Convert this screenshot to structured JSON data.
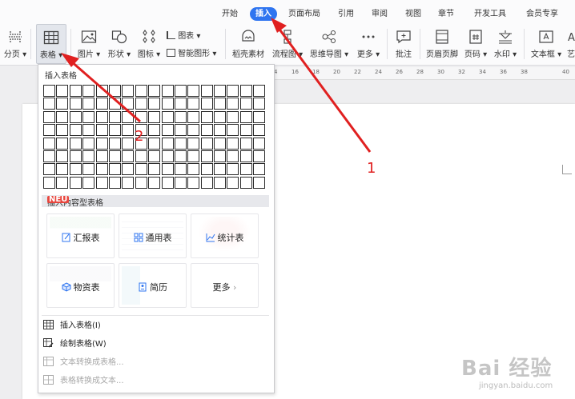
{
  "menu": {
    "tabs": [
      "开始",
      "插入",
      "页面布局",
      "引用",
      "审阅",
      "视图",
      "章节",
      "开发工具",
      "会员专享"
    ],
    "active": "插入"
  },
  "ribbon": {
    "fenye": "分页",
    "biaoge": "表格",
    "tupian": "图片",
    "xingzhuang": "形状",
    "tubiao": "图标",
    "tubiao2": "图表",
    "zhineng": "智能图形",
    "daoke": "稻壳素材",
    "liucheng": "流程图",
    "siwei": "思维导图",
    "gengduo": "更多",
    "pizhu": "批注",
    "yemei": "页眉页脚",
    "yema": "页码",
    "shuiyin": "水印",
    "wenben": "文本框",
    "cut": "艺"
  },
  "ruler": [
    "4",
    "16",
    "18",
    "20",
    "22",
    "24",
    "26",
    "28",
    "30",
    "32",
    "34",
    "36",
    "38",
    "40"
  ],
  "panel": {
    "insert_table_title": "插入表格",
    "grid_rows": 8,
    "grid_cols": 17,
    "content_table_title": "插入内容型表格",
    "neu_badge": "NEU",
    "cards": [
      {
        "label": "汇报表",
        "icon": "edit-icon"
      },
      {
        "label": "通用表",
        "icon": "grid-icon"
      },
      {
        "label": "统计表",
        "icon": "chart-icon"
      },
      {
        "label": "物资表",
        "icon": "cube-icon"
      },
      {
        "label": "简历",
        "icon": "resume-icon"
      },
      {
        "label": "更多",
        "icon": "chevron-right-icon"
      }
    ],
    "items": [
      {
        "label": "插入表格(I)",
        "enabled": true
      },
      {
        "label": "绘制表格(W)",
        "enabled": true
      },
      {
        "label": "文本转换成表格...",
        "enabled": false
      },
      {
        "label": "表格转换成文本...",
        "enabled": false
      }
    ]
  },
  "annotations": {
    "marker1": "1",
    "marker2": "2"
  },
  "watermark": {
    "main": "Bai 经验",
    "sub": "jingyan.baidu.com"
  },
  "colors": {
    "accent": "#2f75f0",
    "arrow": "#e02020",
    "neu": "#e8463e"
  }
}
